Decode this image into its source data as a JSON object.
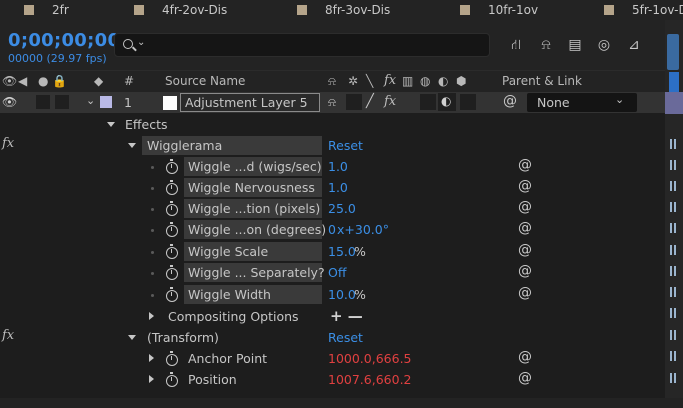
{
  "comp_tabs": [
    {
      "label": "2fr"
    },
    {
      "label": "4fr-2ov-Dis"
    },
    {
      "label": "8fr-3ov-Dis"
    },
    {
      "label": "10fr-1ov"
    },
    {
      "label": "5fr-1ov-Dis"
    }
  ],
  "header": {
    "timecode": "0;00;00;00",
    "frame_info": "00000 (29.97 fps)",
    "search_placeholder": ""
  },
  "columns": {
    "number": "#",
    "source_name": "Source Name",
    "switches_fx": "fx",
    "parent_link": "Parent & Link"
  },
  "layer": {
    "index": "1",
    "name": "Adjustment Layer 5",
    "label_color": "#b9b9e6",
    "parent_value": "None"
  },
  "effects_label": "Effects",
  "wigglerama": {
    "name": "Wigglerama",
    "reset": "Reset",
    "props": [
      {
        "name": "Wiggle ...d (wigs/sec)",
        "value": "1.0",
        "unit": ""
      },
      {
        "name": "Wiggle Nervousness",
        "value": "1.0",
        "unit": ""
      },
      {
        "name": "Wiggle ...tion (pixels)",
        "value": "25.0",
        "unit": ""
      },
      {
        "name": "Wiggle ...on (degrees)",
        "value": "0",
        "unit": "x+30.0°"
      },
      {
        "name": "Wiggle Scale",
        "value": "15.0",
        "unit": "%"
      },
      {
        "name": "Wiggle ... Separately?",
        "value": "Off",
        "unit": ""
      },
      {
        "name": "Wiggle Width",
        "value": "10.0",
        "unit": "%"
      }
    ]
  },
  "compositing_options": {
    "label": "Compositing Options",
    "controls": "+ —"
  },
  "transform": {
    "name": "(Transform)",
    "reset": "Reset",
    "props": [
      {
        "name": "Anchor Point",
        "value": "1000.0,666.5"
      },
      {
        "name": "Position",
        "value": "1007.6,660.2"
      }
    ]
  },
  "fx_symbol": "fx",
  "colors": {
    "accent_blue": "#3b8fe6",
    "value_red": "#e04040",
    "tab_swatch": "#b5a48a"
  }
}
